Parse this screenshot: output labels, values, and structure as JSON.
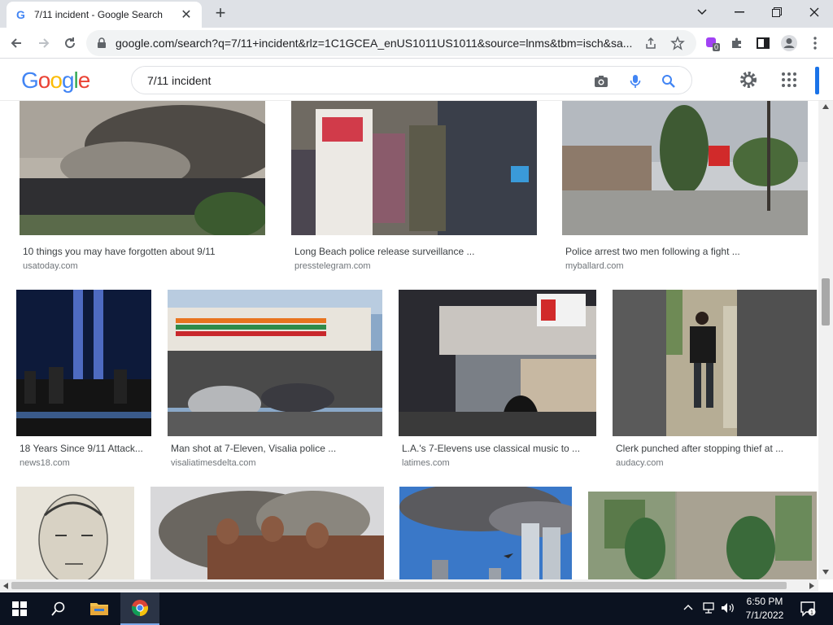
{
  "browser": {
    "tab_title": "7/11 incident - Google Search",
    "url": "google.com/search?q=7/11+incident&rlz=1C1GCEA_enUS1011US1011&source=lnms&tbm=isch&sa...",
    "extension_badge": "0"
  },
  "google": {
    "logo": [
      "G",
      "o",
      "o",
      "g",
      "l",
      "e"
    ],
    "logo_colors": [
      "#4285f4",
      "#ea4335",
      "#fbbc05",
      "#4285f4",
      "#34a853",
      "#ea4335"
    ],
    "query": "7/11 incident"
  },
  "results": [
    {
      "caption": "10 things you may have forgotten about 9/11",
      "source": "usatoday.com"
    },
    {
      "caption": "Long Beach police release surveillance ...",
      "source": "presstelegram.com"
    },
    {
      "caption": "Police arrest two men following a fight ...",
      "source": "myballard.com"
    },
    {
      "caption": "18 Years Since 9/11 Attack...",
      "source": "news18.com"
    },
    {
      "caption": "Man shot at 7-Eleven, Visalia police ...",
      "source": "visaliatimesdelta.com"
    },
    {
      "caption": "L.A.'s 7-Elevens use classical music to ...",
      "source": "latimes.com"
    },
    {
      "caption": "Clerk punched after stopping thief at ...",
      "source": "audacy.com"
    }
  ],
  "taskbar": {
    "time": "6:50 PM",
    "date": "7/1/2022"
  },
  "colors": {
    "accent": "#1a73e8",
    "taskbar": "#0b1220"
  }
}
